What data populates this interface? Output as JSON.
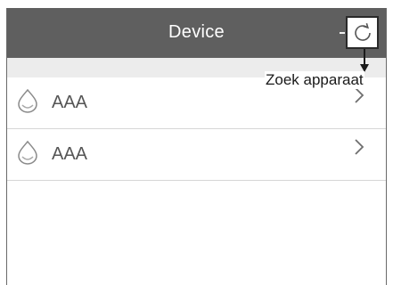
{
  "header": {
    "title": "Device",
    "refresh_icon": "refresh-icon"
  },
  "devices": [
    {
      "name": "AAA",
      "icon": "water-drop-icon"
    },
    {
      "name": "AAA",
      "icon": "water-drop-icon"
    }
  ],
  "annotation": {
    "label": "Zoek apparaat"
  },
  "colors": {
    "header_bg": "#5f5f5f",
    "subbar_bg": "#ececec",
    "text": "#555555"
  }
}
